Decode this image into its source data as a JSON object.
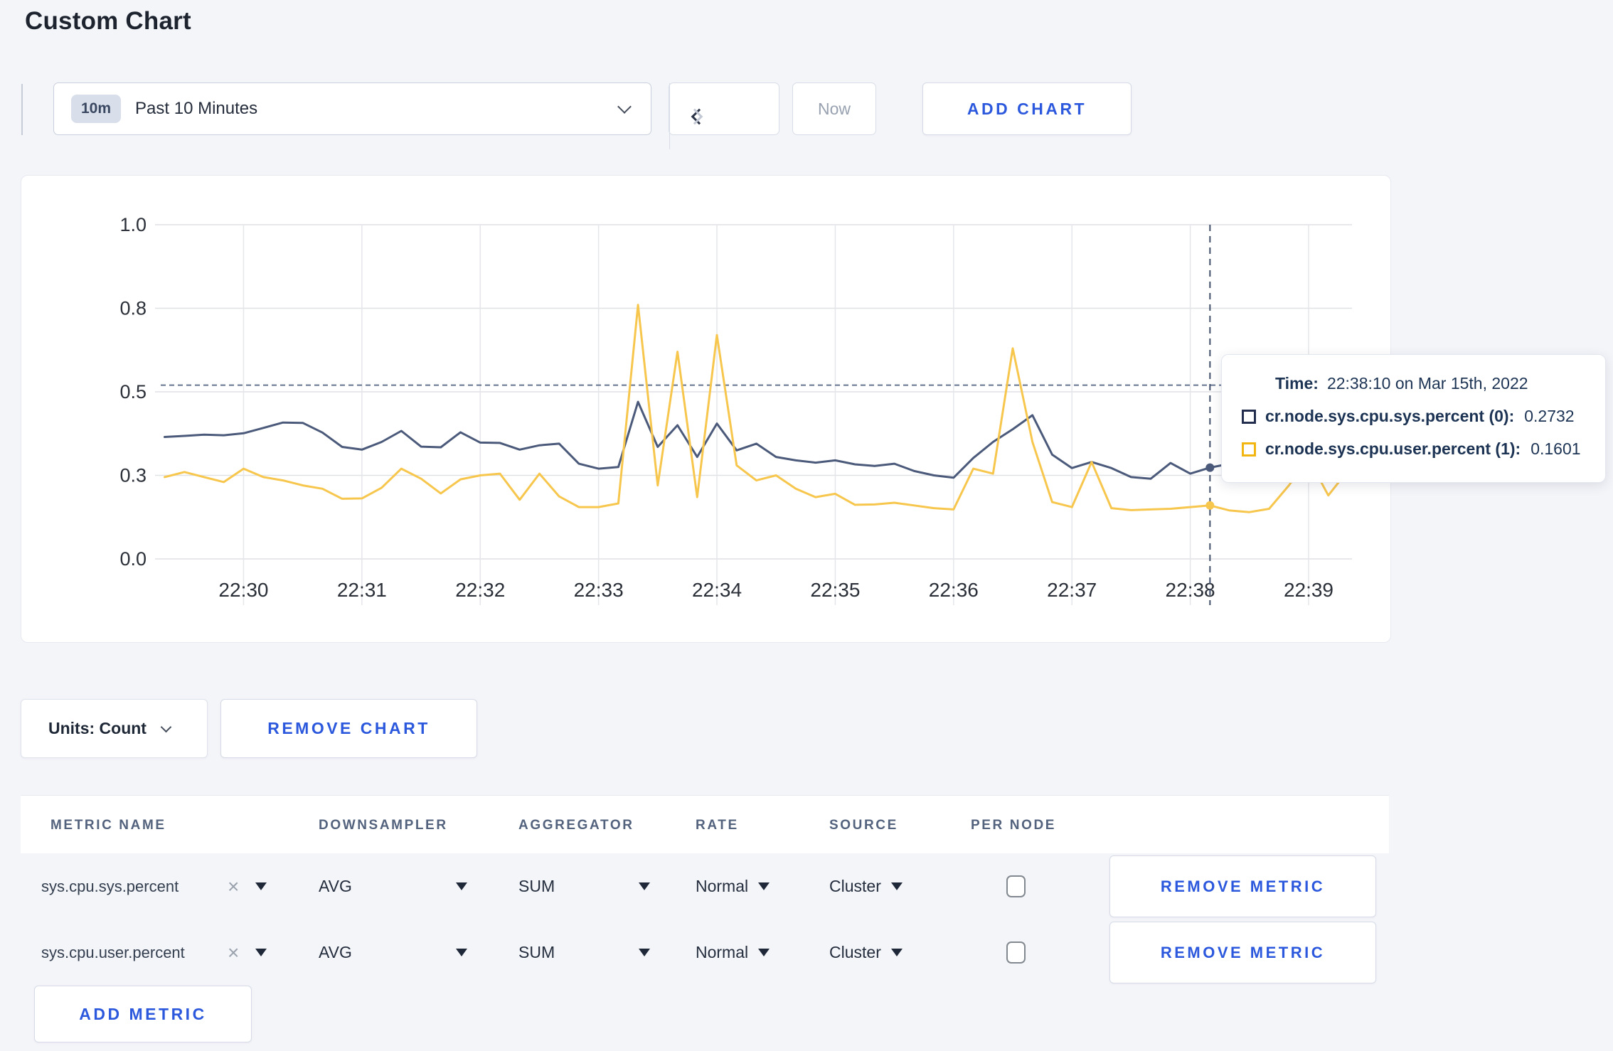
{
  "page": {
    "title": "Custom Chart"
  },
  "colors": {
    "accent_blue": "#2b58dc",
    "page_background": "#f4f5f9",
    "series_sys": "#4b5a7a",
    "series_user": "#f7c64d",
    "gridline": "#e2e3e7",
    "crosshair": "#3e4d69"
  },
  "toolbar": {
    "time_badge": "10m",
    "time_range_label": "Past 10 Minutes",
    "now_label": "Now",
    "add_chart_label": "ADD CHART"
  },
  "chart_data": {
    "type": "line",
    "title": "",
    "xlabel": "",
    "ylabel": "",
    "ylim": [
      0,
      1
    ],
    "grid": true,
    "x_domain_seconds": [
      18,
      622
    ],
    "x_base_time": "22:29:00",
    "x_ticks": [
      {
        "s": 60,
        "label": "22:30"
      },
      {
        "s": 120,
        "label": "22:31"
      },
      {
        "s": 180,
        "label": "22:32"
      },
      {
        "s": 240,
        "label": "22:33"
      },
      {
        "s": 300,
        "label": "22:34"
      },
      {
        "s": 360,
        "label": "22:35"
      },
      {
        "s": 420,
        "label": "22:36"
      },
      {
        "s": 480,
        "label": "22:37"
      },
      {
        "s": 540,
        "label": "22:38"
      },
      {
        "s": 600,
        "label": "22:39"
      }
    ],
    "y_ticks": [
      {
        "v": 0,
        "label": "0.0"
      },
      {
        "v": 0.25,
        "label": "0.3"
      },
      {
        "v": 0.5,
        "label": "0.5"
      },
      {
        "v": 0.75,
        "label": "0.8"
      },
      {
        "v": 1,
        "label": "1.0"
      }
    ],
    "guide_value": 0.52,
    "crosshair_seconds": 550,
    "legend_position": "tooltip",
    "series": [
      {
        "name": "cr.node.sys.cpu.sys.percent",
        "color": "#4b5a7a",
        "marker_value": 0.2732,
        "points": [
          [
            20,
            0.365
          ],
          [
            30,
            0.368
          ],
          [
            40,
            0.372
          ],
          [
            50,
            0.37
          ],
          [
            60,
            0.376
          ],
          [
            70,
            0.392
          ],
          [
            80,
            0.408
          ],
          [
            90,
            0.407
          ],
          [
            100,
            0.378
          ],
          [
            110,
            0.335
          ],
          [
            120,
            0.327
          ],
          [
            130,
            0.35
          ],
          [
            140,
            0.383
          ],
          [
            150,
            0.336
          ],
          [
            160,
            0.334
          ],
          [
            170,
            0.379
          ],
          [
            180,
            0.348
          ],
          [
            190,
            0.347
          ],
          [
            200,
            0.327
          ],
          [
            210,
            0.34
          ],
          [
            220,
            0.345
          ],
          [
            230,
            0.285
          ],
          [
            240,
            0.27
          ],
          [
            250,
            0.275
          ],
          [
            260,
            0.47
          ],
          [
            270,
            0.335
          ],
          [
            280,
            0.4
          ],
          [
            290,
            0.305
          ],
          [
            300,
            0.405
          ],
          [
            310,
            0.325
          ],
          [
            320,
            0.345
          ],
          [
            330,
            0.305
          ],
          [
            340,
            0.295
          ],
          [
            350,
            0.288
          ],
          [
            360,
            0.295
          ],
          [
            370,
            0.283
          ],
          [
            380,
            0.278
          ],
          [
            390,
            0.285
          ],
          [
            400,
            0.263
          ],
          [
            410,
            0.25
          ],
          [
            420,
            0.243
          ],
          [
            430,
            0.302
          ],
          [
            440,
            0.35
          ],
          [
            450,
            0.388
          ],
          [
            460,
            0.43
          ],
          [
            470,
            0.312
          ],
          [
            480,
            0.272
          ],
          [
            490,
            0.29
          ],
          [
            500,
            0.272
          ],
          [
            510,
            0.245
          ],
          [
            520,
            0.24
          ],
          [
            530,
            0.287
          ],
          [
            540,
            0.255
          ],
          [
            550,
            0.2732
          ],
          [
            560,
            0.285
          ],
          [
            570,
            0.3
          ],
          [
            580,
            0.285
          ],
          [
            590,
            0.28
          ],
          [
            600,
            0.295
          ],
          [
            610,
            0.288
          ],
          [
            620,
            0.3
          ]
        ]
      },
      {
        "name": "cr.node.sys.cpu.user.percent",
        "color": "#f7c64d",
        "marker_value": 0.1601,
        "points": [
          [
            20,
            0.245
          ],
          [
            30,
            0.26
          ],
          [
            40,
            0.245
          ],
          [
            50,
            0.23
          ],
          [
            60,
            0.27
          ],
          [
            70,
            0.245
          ],
          [
            80,
            0.235
          ],
          [
            90,
            0.22
          ],
          [
            100,
            0.21
          ],
          [
            110,
            0.18
          ],
          [
            120,
            0.181
          ],
          [
            130,
            0.213
          ],
          [
            140,
            0.27
          ],
          [
            150,
            0.24
          ],
          [
            160,
            0.196
          ],
          [
            170,
            0.238
          ],
          [
            180,
            0.25
          ],
          [
            190,
            0.255
          ],
          [
            200,
            0.177
          ],
          [
            210,
            0.255
          ],
          [
            220,
            0.187
          ],
          [
            230,
            0.155
          ],
          [
            240,
            0.155
          ],
          [
            250,
            0.166
          ],
          [
            260,
            0.76
          ],
          [
            270,
            0.22
          ],
          [
            280,
            0.62
          ],
          [
            290,
            0.185
          ],
          [
            300,
            0.67
          ],
          [
            310,
            0.28
          ],
          [
            320,
            0.235
          ],
          [
            330,
            0.25
          ],
          [
            340,
            0.21
          ],
          [
            350,
            0.185
          ],
          [
            360,
            0.195
          ],
          [
            370,
            0.162
          ],
          [
            380,
            0.163
          ],
          [
            390,
            0.168
          ],
          [
            400,
            0.16
          ],
          [
            410,
            0.152
          ],
          [
            420,
            0.148
          ],
          [
            430,
            0.27
          ],
          [
            440,
            0.255
          ],
          [
            450,
            0.63
          ],
          [
            460,
            0.35
          ],
          [
            470,
            0.17
          ],
          [
            480,
            0.155
          ],
          [
            490,
            0.29
          ],
          [
            500,
            0.152
          ],
          [
            510,
            0.146
          ],
          [
            520,
            0.148
          ],
          [
            530,
            0.15
          ],
          [
            540,
            0.155
          ],
          [
            550,
            0.1601
          ],
          [
            560,
            0.145
          ],
          [
            570,
            0.14
          ],
          [
            580,
            0.15
          ],
          [
            590,
            0.22
          ],
          [
            600,
            0.3
          ],
          [
            610,
            0.19
          ],
          [
            620,
            0.265
          ]
        ]
      }
    ]
  },
  "tooltip": {
    "time_label": "Time:",
    "time_value": "22:38:10 on Mar 15th, 2022",
    "rows": [
      {
        "swatch_color": "#232d4d",
        "label": "cr.node.sys.cpu.sys.percent (0):",
        "value": "0.2732"
      },
      {
        "swatch_color": "#f1b612",
        "label": "cr.node.sys.cpu.user.percent (1):",
        "value": "0.1601"
      }
    ]
  },
  "chart_controls": {
    "units_label": "Units: Count",
    "remove_chart_label": "REMOVE CHART"
  },
  "metrics_table": {
    "headers": [
      "METRIC NAME",
      "DOWNSAMPLER",
      "AGGREGATOR",
      "RATE",
      "SOURCE",
      "PER NODE"
    ],
    "rows": [
      {
        "metric": "sys.cpu.sys.percent",
        "downsampler": "AVG",
        "aggregator": "SUM",
        "rate": "Normal",
        "source": "Cluster",
        "per_node_checked": false,
        "remove_label": "REMOVE METRIC"
      },
      {
        "metric": "sys.cpu.user.percent",
        "downsampler": "AVG",
        "aggregator": "SUM",
        "rate": "Normal",
        "source": "Cluster",
        "per_node_checked": false,
        "remove_label": "REMOVE METRIC"
      }
    ],
    "add_metric_label": "ADD METRIC"
  }
}
